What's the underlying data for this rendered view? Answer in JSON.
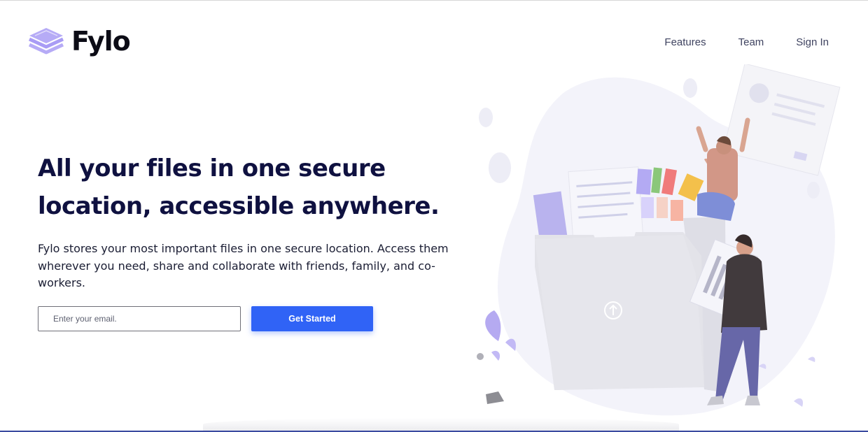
{
  "brand": {
    "name": "Fylo",
    "logo_icon": "stacked-layers-icon",
    "accent_color": "#a99cf5"
  },
  "nav": {
    "items": [
      {
        "label": "Features"
      },
      {
        "label": "Team"
      },
      {
        "label": "Sign In"
      }
    ]
  },
  "hero": {
    "title": "All your files in one secure location, accessible anywhere.",
    "description": "Fylo stores your most important files in one secure location. Access them wherever you need, share and collaborate with friends, family, and co-workers.",
    "email_placeholder": "Enter your email.",
    "cta_label": "Get Started",
    "cta_color": "#3063f6",
    "title_color": "#0f1140"
  },
  "illustration": {
    "subject": "people-organizing-files-illustration",
    "folder_icon": "upload-arrow-icon"
  }
}
